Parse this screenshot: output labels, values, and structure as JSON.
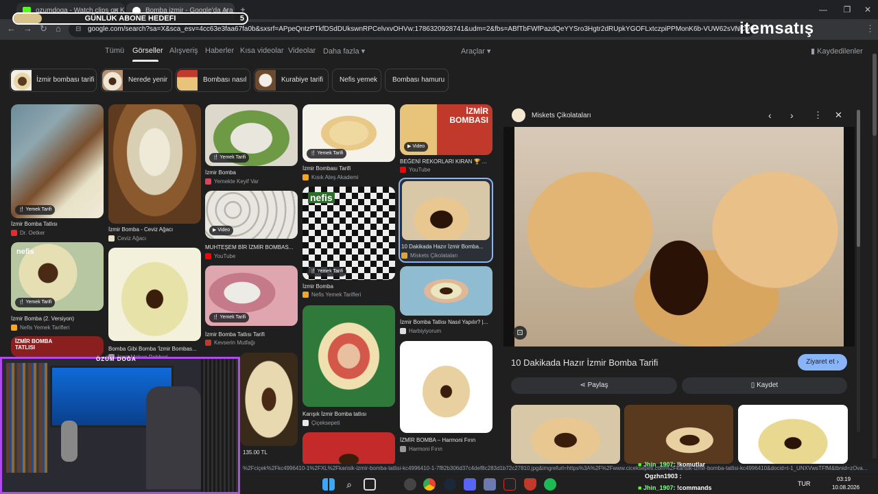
{
  "browser": {
    "tabs": [
      {
        "title": "ozumdoga - Watch clips on Ki...",
        "color": "#53fc18"
      },
      {
        "title": "Bomba izmir - Google'da Ara",
        "color": "#4285f4"
      }
    ],
    "url": "google.com/search?sa=X&sca_esv=4cc63e3faa67fa0b&sxsrf=APpeQntzPTkfDSdDUkswnRPCelvxvOHVw:1786320928741&udm=2&fbs=ABfTbFWfPazdQeYYSro3Hgtr2dRUpkYGOFLxtczpiPPMonK6b-VUW62sVNClvOjXudyfFYR9..."
  },
  "overlay": {
    "goal_label": "GÜNLÜK ABONE HEDEFI",
    "goal_count": "5",
    "goal_progress": 0.12,
    "brand": "itemsatış",
    "cam_label": "ÖZÜM DOĞA"
  },
  "google": {
    "tabs": [
      "Tümü",
      "Görseller",
      "Alışveriş",
      "Haberler",
      "Kısa videolar",
      "Videolar",
      "Daha fazla"
    ],
    "tools": "Araçlar",
    "saved": "Kaydedilenler",
    "chips": [
      "İzmir bombası tarifi",
      "Nerede yenir",
      "Bombası nasıl",
      "Kurabiye tarifi",
      "Nefis yemek",
      "Bombası hamuru"
    ]
  },
  "results": [
    {
      "caption": "İzmir Bomba Tatlısı",
      "source": "Dr. Oetker",
      "badge": "Yemek Tarifi"
    },
    {
      "caption": "İzmir Bomba (2. Versiyon)",
      "source": "Nefis Yemek Tarifleri",
      "badge": "Yemek Tarifi"
    },
    {
      "caption": "İzmir Bomba - Ceviz Ağacı",
      "source": "Ceviz Ağacı",
      "badge": ""
    },
    {
      "caption": "Bomba Gibi Bomba 'İzmir Bombas...",
      "source": "İzmir Mekan Rehberi",
      "badge": ""
    },
    {
      "caption": "İzmir Bomba",
      "source": "Yemekte Keyif Var",
      "badge": "Yemek Tarifi"
    },
    {
      "caption": "MUHTEŞEM BİR İZMİR BOMBAS...",
      "source": "YouTube",
      "badge": "Video"
    },
    {
      "caption": "İzmir Bomba Tatlısı Tarifi",
      "source": "Kevserin Mutfağı",
      "badge": "Yemek Tarifi"
    },
    {
      "caption": "135.00 TL",
      "source": "",
      "badge": ""
    },
    {
      "caption": "İzmir Bombası Tarifi",
      "source": "Kısık Ateş Akademi",
      "badge": "Yemek Tarifi"
    },
    {
      "caption": "İzmir Bomba",
      "source": "Nefis Yemek Tarifleri",
      "badge": "Yemek Tarifi"
    },
    {
      "caption": "Karışık İzmir Bomba tatlısı",
      "source": "Çiçeksepeti",
      "badge": ""
    },
    {
      "caption": "BEĞENİ REKORLARI KIRAN 🏆 ...",
      "source": "YouTube",
      "badge": "Video"
    },
    {
      "caption": "10 Dakikada Hazır İzmir Bomba...",
      "source": "Miskets Çikolataları",
      "badge": ""
    },
    {
      "caption": "İzmir Bomba Tatlısı Nasıl Yapılır? |...",
      "source": "Harbiyiyorum",
      "badge": ""
    },
    {
      "caption": "İZMİR BOMBA – Harmoni Fırın",
      "source": "Harmoni Fırın",
      "badge": ""
    }
  ],
  "overlay_text": {
    "izmir_bombasi": [
      "İZMİR",
      "BOMBASI"
    ],
    "nefis": "nefis",
    "izmir_tatlisi": [
      "İZMİR",
      "BOMBA",
      "TATLISI"
    ]
  },
  "panel": {
    "source": "Miskets Çikolataları",
    "title": "10 Dakikada Hazır İzmir Bomba Tarifi",
    "visit": "Ziyaret et",
    "share": "Paylaş",
    "save": "Kaydet"
  },
  "status_url": "%2Fciçek%2Fkc4996410-1%2FXL%2Fkarisik-izmir-bomba-tatlisi-kc4996410-1-7f82b306d37c4def8c283d1b72c27810.jpg&imgrefurl=https%3A%2F%2Fwww.ciceksepeti.com%2Fkarisik-izmir-bomba-tatlisi-kc4996410&docid=t-1_UNXVwsTFfM&tbnid=zOva...",
  "chat": [
    {
      "user": "Jhin_1907",
      "text": ": !komutlar"
    },
    {
      "user": "Ogzhn1903",
      "text": ":"
    },
    {
      "user": "Jhin_1907",
      "text": ": !commands"
    }
  ],
  "taskbar": {
    "lang": "TUR",
    "time": "03:19",
    "date": "10.08.2026"
  }
}
